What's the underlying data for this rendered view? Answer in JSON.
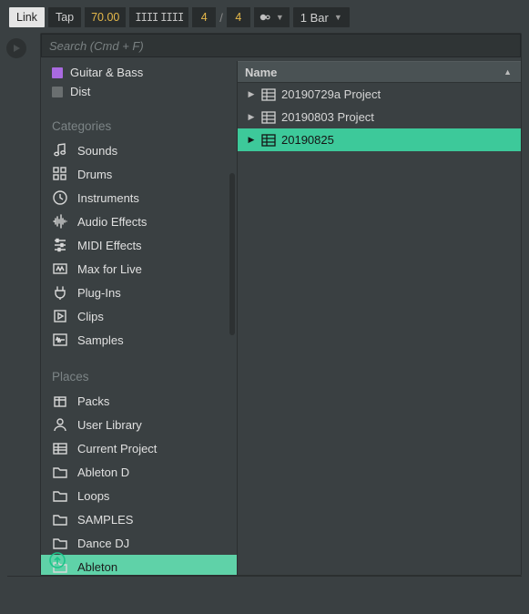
{
  "toolbar": {
    "link": "Link",
    "tap": "Tap",
    "tempo": "70.00",
    "sig_num": "4",
    "sig_den": "4",
    "quantize": "1 Bar"
  },
  "search": {
    "placeholder": "Search (Cmd + F)"
  },
  "collections": [
    {
      "label": "Guitar & Bass",
      "color": "purple"
    },
    {
      "label": "Dist",
      "color": "gray"
    }
  ],
  "sections": {
    "categories": "Categories",
    "places": "Places"
  },
  "categories": [
    {
      "label": "Sounds",
      "icon": "note"
    },
    {
      "label": "Drums",
      "icon": "pads"
    },
    {
      "label": "Instruments",
      "icon": "clock"
    },
    {
      "label": "Audio Effects",
      "icon": "wave"
    },
    {
      "label": "MIDI Effects",
      "icon": "sliders"
    },
    {
      "label": "Max for Live",
      "icon": "max"
    },
    {
      "label": "Plug-Ins",
      "icon": "plug"
    },
    {
      "label": "Clips",
      "icon": "clip"
    },
    {
      "label": "Samples",
      "icon": "sample"
    }
  ],
  "places": [
    {
      "label": "Packs",
      "icon": "pack"
    },
    {
      "label": "User Library",
      "icon": "user"
    },
    {
      "label": "Current Project",
      "icon": "proj"
    },
    {
      "label": "Ableton D",
      "icon": "folder"
    },
    {
      "label": "Loops",
      "icon": "folder"
    },
    {
      "label": "SAMPLES",
      "icon": "folder"
    },
    {
      "label": "Dance DJ",
      "icon": "folder"
    },
    {
      "label": "Ableton",
      "icon": "folder",
      "selected": true
    }
  ],
  "results_header": "Name",
  "results": [
    {
      "name": "20190729a Project"
    },
    {
      "name": "20190803 Project"
    },
    {
      "name": "20190825",
      "selected": true
    }
  ]
}
